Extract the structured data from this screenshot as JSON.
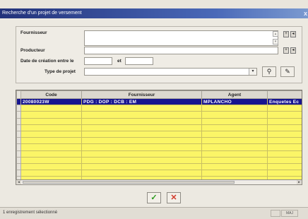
{
  "window": {
    "title": "Recherche d'un projet de versement",
    "close_label": "x"
  },
  "criteria": {
    "fournisseur_label": "Fournisseur",
    "producteur_label": "Producteur",
    "date_label": "Date de création entre le",
    "date_and_label": "et",
    "type_label": "Type de projet",
    "date_from": "",
    "date_to": "",
    "type_value": ""
  },
  "grid": {
    "columns": [
      "Code",
      "Fournisseur",
      "Agent",
      ""
    ],
    "rows": [
      {
        "code": "20080023W",
        "fournisseur": "PDG : DOP : DCB : EM",
        "agent": "MPLANCHO",
        "extra": "Enquetes Ec"
      }
    ]
  },
  "buttons": {
    "ok": "✓",
    "cancel": "✕"
  },
  "status": {
    "text": "1 enregistrement sélectionné",
    "pane2": "MAJ"
  }
}
